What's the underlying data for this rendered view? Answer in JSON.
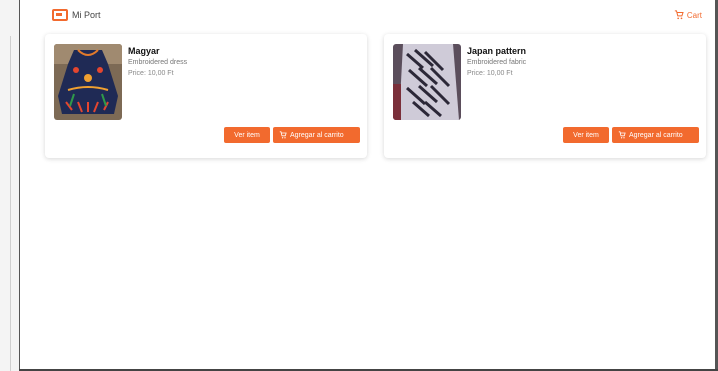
{
  "app": {
    "brand": "Mi Port",
    "cart_label": "Cart",
    "accent": "#f26a2e"
  },
  "products": [
    {
      "name": "Magyar",
      "subtitle": "Embroidered dress",
      "meta": "Price: 10,00 Ft",
      "view_label": "Ver item",
      "add_label": "Agregar al carrito",
      "image_icon": "embroidered-dress-image"
    },
    {
      "name": "Japan pattern",
      "subtitle": "Embroidered fabric",
      "meta": "Price: 10,00 Ft",
      "view_label": "Ver item",
      "add_label": "Agregar al carrito",
      "image_icon": "woven-pattern-image"
    }
  ]
}
